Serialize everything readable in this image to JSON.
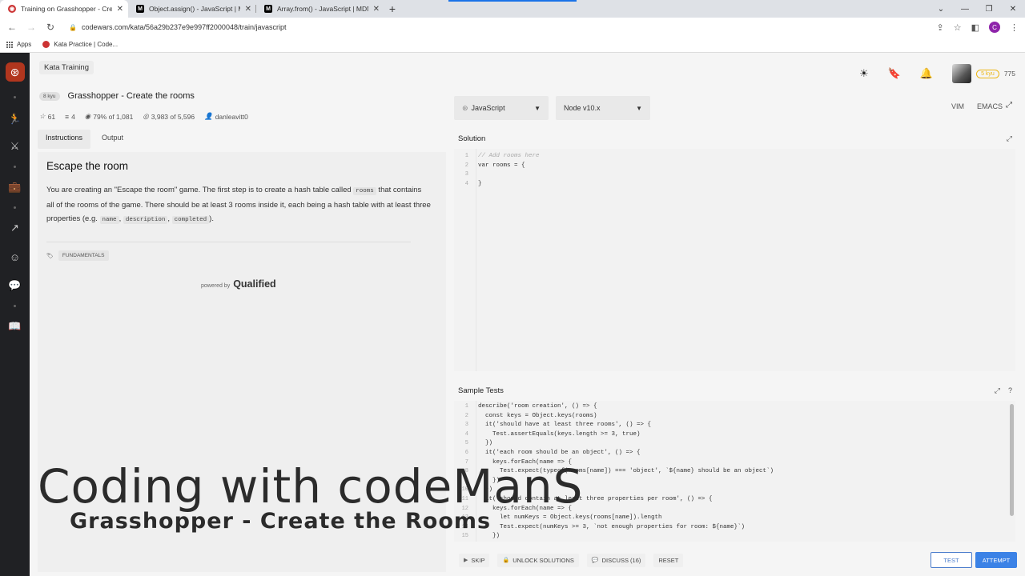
{
  "browser": {
    "tabs": [
      {
        "label": "Training on Grasshopper - Create the rooms",
        "icon": "codewars-icon",
        "active": true
      },
      {
        "label": "Object.assign() - JavaScript | MDN",
        "icon": "mdn-icon",
        "active": false
      },
      {
        "label": "Array.from() - JavaScript | MDN",
        "icon": "mdn-icon",
        "active": false
      }
    ],
    "url": "codewars.com/kata/56a29b237e9e997ff2000048/train/javascript",
    "profile_letter": "C",
    "bookmarks": [
      {
        "label": "Apps"
      },
      {
        "label": "Kata Practice | Code..."
      }
    ]
  },
  "header": {
    "breadcrumb": "Kata Training",
    "user_rank": "5 kyu",
    "honor": "775"
  },
  "kata": {
    "rank": "8 kyu",
    "title": "Grasshopper - Create the rooms",
    "stars": "61",
    "collections": "4",
    "satisfaction": "79% of 1,081",
    "completions": "3,983 of 5,596",
    "author": "danleavitt0",
    "tabs": [
      "Instructions",
      "Output"
    ],
    "heading": "Escape the room",
    "desc_part1": "You are creating an \"Escape the room\" game. The first step is to create a hash table called ",
    "desc_code1": "rooms",
    "desc_part2": " that contains all of the rooms of the game. There should be at least 3 rooms inside it, each being a hash table with at least three properties (e.g. ",
    "desc_code2": "name",
    "desc_sep1": ", ",
    "desc_code3": "description",
    "desc_sep2": ", ",
    "desc_code4": "completed",
    "desc_part3": ").",
    "tag": "FUNDAMENTALS",
    "powered_by": "powered by",
    "brand": "Qualified"
  },
  "overlay": {
    "main": "Coding with codeManS",
    "sub": "Grasshopper - Create the Rooms"
  },
  "editor": {
    "language": "JavaScript",
    "runtime": "Node v10.x",
    "modes": [
      "VIM",
      "EMACS"
    ],
    "solution_title": "Solution",
    "solution_lines": [
      "// Add rooms here",
      "var rooms = {",
      "",
      "}"
    ],
    "tests_title": "Sample Tests",
    "test_lines": [
      "describe('room creation', () => {",
      "  const keys = Object.keys(rooms)",
      "  it('should have at least three rooms', () => {",
      "    Test.assertEquals(keys.length >= 3, true)",
      "  })",
      "  it('each room should be an object', () => {",
      "    keys.forEach(name => {",
      "      Test.expect(typeof(rooms[name]) === 'object', `${name} should be an object`)",
      "    })",
      "  })",
      "  it('should contain at least three properties per room', () => {",
      "    keys.forEach(name => {",
      "      let numKeys = Object.keys(rooms[name]).length",
      "      Test.expect(numKeys >= 3, `not enough properties for room: ${name}`)",
      "    })"
    ]
  },
  "actions": {
    "skip": "SKIP",
    "unlock": "UNLOCK SOLUTIONS",
    "discuss": "DISCUSS (16)",
    "reset": "RESET",
    "test": "TEST",
    "attempt": "ATTEMPT"
  }
}
